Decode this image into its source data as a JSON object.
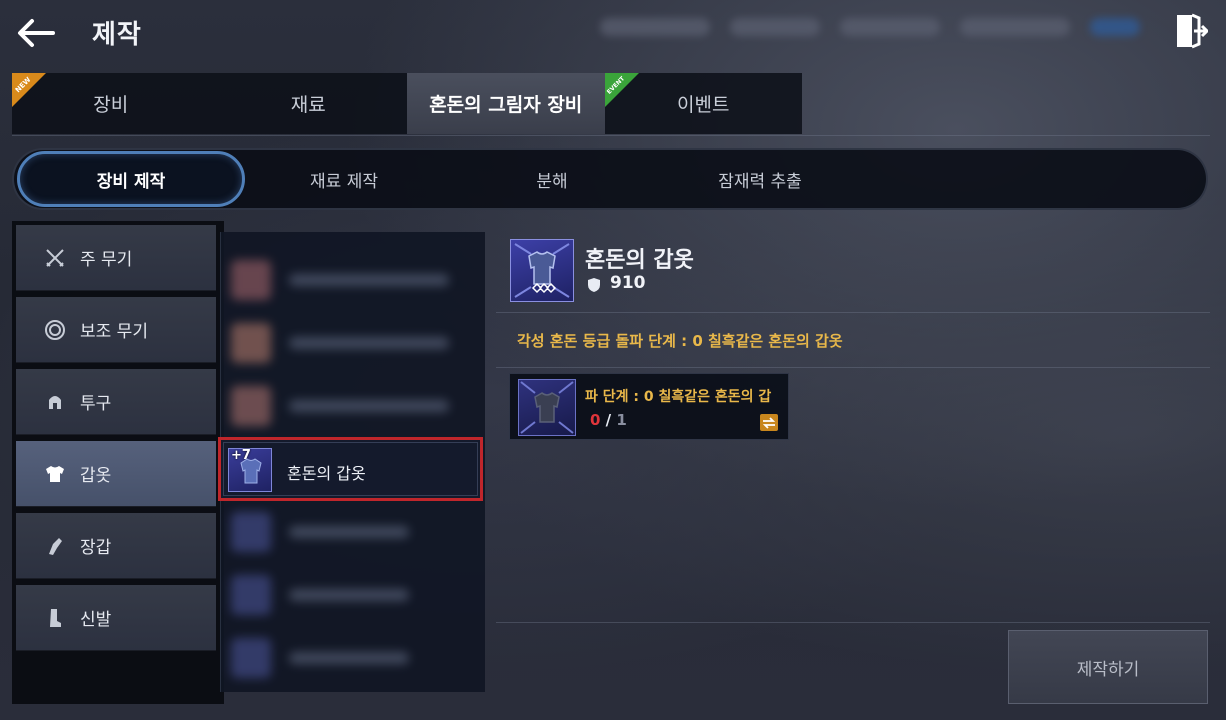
{
  "header": {
    "title": "제작",
    "back_icon": "back-arrow-icon",
    "exit_icon": "exit-door-icon"
  },
  "top_tabs": [
    {
      "label": "장비",
      "badge": "NEW",
      "badge_color": "#d98a1b"
    },
    {
      "label": "재료"
    },
    {
      "label": "혼돈의 그림자 장비",
      "active": true
    },
    {
      "label": "이벤트",
      "badge": "EVENT",
      "badge_color": "#3aa43a"
    }
  ],
  "sub_tabs": [
    {
      "label": "장비 제작",
      "active": true
    },
    {
      "label": "재료 제작"
    },
    {
      "label": "분해"
    },
    {
      "label": "잠재력 추출"
    }
  ],
  "categories": [
    {
      "label": "주 무기",
      "icon": "crossed-swords-icon"
    },
    {
      "label": "보조 무기",
      "icon": "ring-icon"
    },
    {
      "label": "투구",
      "icon": "helmet-icon"
    },
    {
      "label": "갑옷",
      "icon": "armor-icon",
      "active": true
    },
    {
      "label": "장갑",
      "icon": "glove-icon"
    },
    {
      "label": "신발",
      "icon": "boot-icon"
    }
  ],
  "item_list": {
    "selected": {
      "name": "혼돈의 갑옷",
      "enhance": "+7"
    }
  },
  "detail": {
    "name": "혼돈의 갑옷",
    "stat_icon": "shield-icon",
    "stat_value": "910",
    "requirement": "각성 혼돈 등급 돌파 단계 : 0 칠흑같은 혼돈의 갑옷"
  },
  "material": {
    "name": "파 단계 : 0 칠흑같은 혼돈의 갑",
    "have": "0",
    "separator": "/",
    "need": "1",
    "link_icon": "exchange-icon"
  },
  "craft_button": "제작하기",
  "colors": {
    "accent_gold": "#e9b84a",
    "selection_red": "#c0262b",
    "active_tab_border": "#4f7fb8"
  }
}
